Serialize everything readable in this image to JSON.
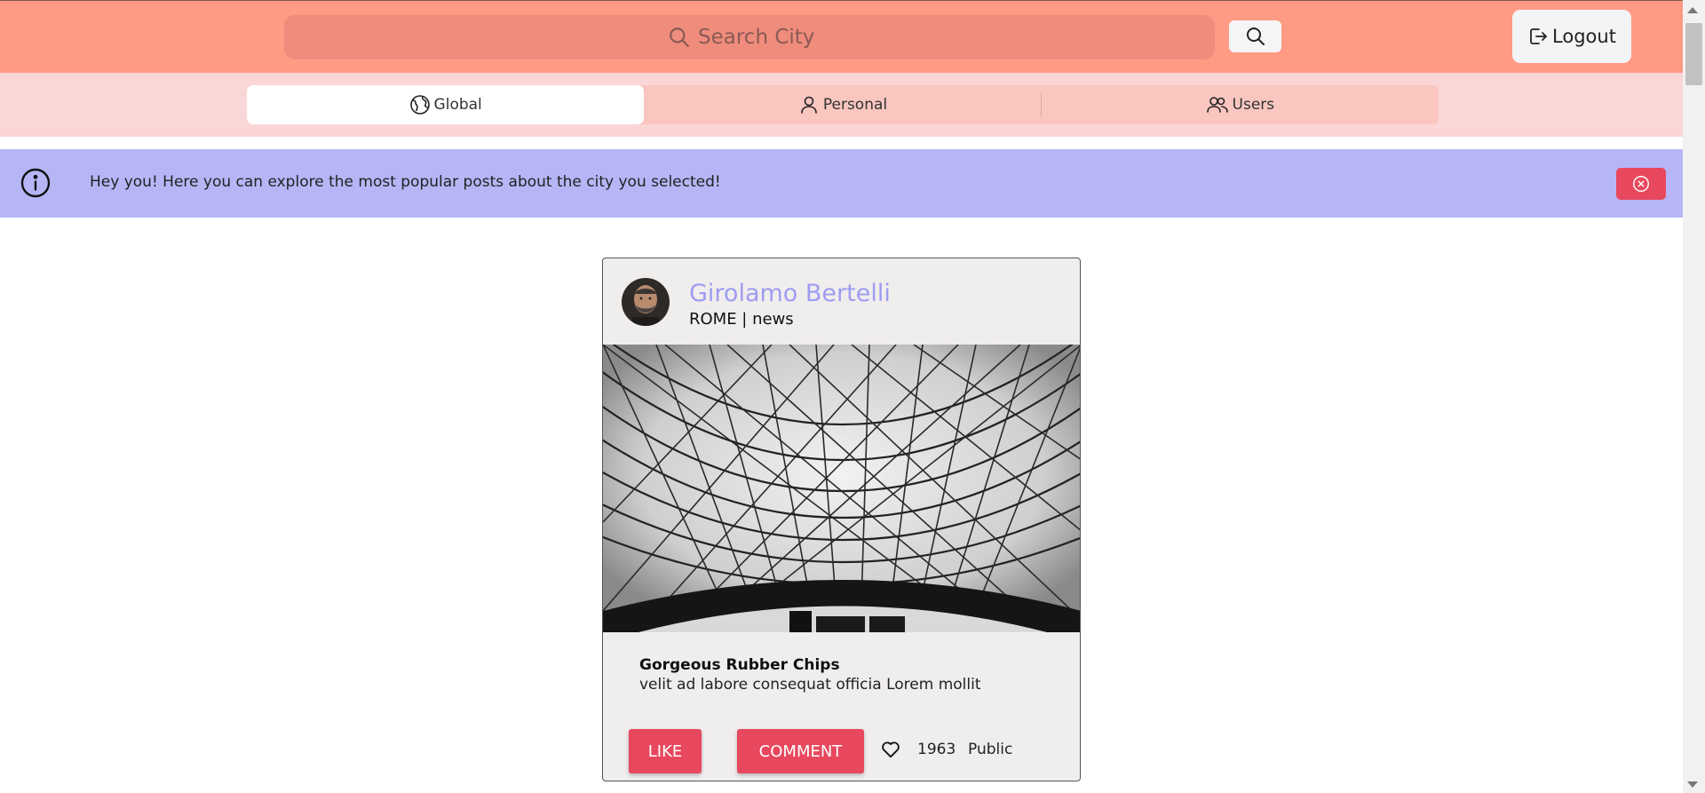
{
  "header": {
    "search_placeholder": "Search City",
    "search_icon": "search-icon",
    "logout_label": "Logout",
    "logout_icon": "logout-icon"
  },
  "tabs": [
    {
      "label": "Global",
      "icon": "globe-icon",
      "active": true
    },
    {
      "label": "Personal",
      "icon": "user-icon",
      "active": false
    },
    {
      "label": "Users",
      "icon": "users-icon",
      "active": false
    }
  ],
  "banner": {
    "message": "Hey you! Here you can explore the most popular posts about the city you selected!",
    "icon": "info-icon",
    "close_icon": "close-circle-icon"
  },
  "post": {
    "author": "Girolamo Bertelli",
    "city": "ROME",
    "category": "news",
    "meta": "ROME | news",
    "title": "Gorgeous Rubber Chips",
    "body": "velit ad labore consequat officia Lorem mollit",
    "like_label": "LIKE",
    "comment_label": "COMMENT",
    "likes_count": "1963",
    "visibility": "Public"
  },
  "colors": {
    "topbar": "#ff9a85",
    "tabbar": "#fbd6d6",
    "banner": "#b6b6f7",
    "accent": "#e8485e",
    "author": "#9e9cf2"
  }
}
